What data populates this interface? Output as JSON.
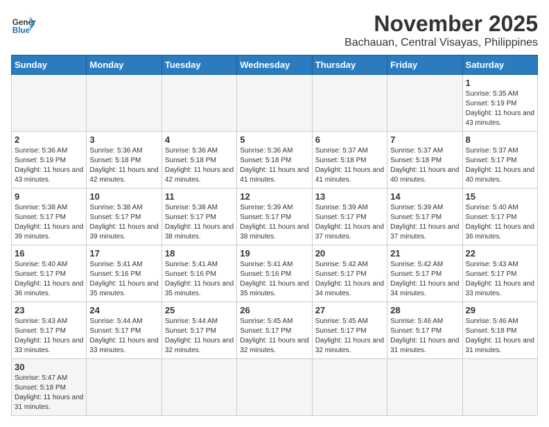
{
  "header": {
    "logo_general": "General",
    "logo_blue": "Blue",
    "month_title": "November 2025",
    "location": "Bachauan, Central Visayas, Philippines"
  },
  "weekdays": [
    "Sunday",
    "Monday",
    "Tuesday",
    "Wednesday",
    "Thursday",
    "Friday",
    "Saturday"
  ],
  "weeks": [
    [
      {
        "day": "",
        "sunrise": "",
        "sunset": "",
        "daylight": ""
      },
      {
        "day": "",
        "sunrise": "",
        "sunset": "",
        "daylight": ""
      },
      {
        "day": "",
        "sunrise": "",
        "sunset": "",
        "daylight": ""
      },
      {
        "day": "",
        "sunrise": "",
        "sunset": "",
        "daylight": ""
      },
      {
        "day": "",
        "sunrise": "",
        "sunset": "",
        "daylight": ""
      },
      {
        "day": "",
        "sunrise": "",
        "sunset": "",
        "daylight": ""
      },
      {
        "day": "1",
        "sunrise": "Sunrise: 5:35 AM",
        "sunset": "Sunset: 5:19 PM",
        "daylight": "Daylight: 11 hours and 43 minutes."
      }
    ],
    [
      {
        "day": "2",
        "sunrise": "Sunrise: 5:36 AM",
        "sunset": "Sunset: 5:19 PM",
        "daylight": "Daylight: 11 hours and 43 minutes."
      },
      {
        "day": "3",
        "sunrise": "Sunrise: 5:36 AM",
        "sunset": "Sunset: 5:18 PM",
        "daylight": "Daylight: 11 hours and 42 minutes."
      },
      {
        "day": "4",
        "sunrise": "Sunrise: 5:36 AM",
        "sunset": "Sunset: 5:18 PM",
        "daylight": "Daylight: 11 hours and 42 minutes."
      },
      {
        "day": "5",
        "sunrise": "Sunrise: 5:36 AM",
        "sunset": "Sunset: 5:18 PM",
        "daylight": "Daylight: 11 hours and 41 minutes."
      },
      {
        "day": "6",
        "sunrise": "Sunrise: 5:37 AM",
        "sunset": "Sunset: 5:18 PM",
        "daylight": "Daylight: 11 hours and 41 minutes."
      },
      {
        "day": "7",
        "sunrise": "Sunrise: 5:37 AM",
        "sunset": "Sunset: 5:18 PM",
        "daylight": "Daylight: 11 hours and 40 minutes."
      },
      {
        "day": "8",
        "sunrise": "Sunrise: 5:37 AM",
        "sunset": "Sunset: 5:17 PM",
        "daylight": "Daylight: 11 hours and 40 minutes."
      }
    ],
    [
      {
        "day": "9",
        "sunrise": "Sunrise: 5:38 AM",
        "sunset": "Sunset: 5:17 PM",
        "daylight": "Daylight: 11 hours and 39 minutes."
      },
      {
        "day": "10",
        "sunrise": "Sunrise: 5:38 AM",
        "sunset": "Sunset: 5:17 PM",
        "daylight": "Daylight: 11 hours and 39 minutes."
      },
      {
        "day": "11",
        "sunrise": "Sunrise: 5:38 AM",
        "sunset": "Sunset: 5:17 PM",
        "daylight": "Daylight: 11 hours and 38 minutes."
      },
      {
        "day": "12",
        "sunrise": "Sunrise: 5:39 AM",
        "sunset": "Sunset: 5:17 PM",
        "daylight": "Daylight: 11 hours and 38 minutes."
      },
      {
        "day": "13",
        "sunrise": "Sunrise: 5:39 AM",
        "sunset": "Sunset: 5:17 PM",
        "daylight": "Daylight: 11 hours and 37 minutes."
      },
      {
        "day": "14",
        "sunrise": "Sunrise: 5:39 AM",
        "sunset": "Sunset: 5:17 PM",
        "daylight": "Daylight: 11 hours and 37 minutes."
      },
      {
        "day": "15",
        "sunrise": "Sunrise: 5:40 AM",
        "sunset": "Sunset: 5:17 PM",
        "daylight": "Daylight: 11 hours and 36 minutes."
      }
    ],
    [
      {
        "day": "16",
        "sunrise": "Sunrise: 5:40 AM",
        "sunset": "Sunset: 5:17 PM",
        "daylight": "Daylight: 11 hours and 36 minutes."
      },
      {
        "day": "17",
        "sunrise": "Sunrise: 5:41 AM",
        "sunset": "Sunset: 5:16 PM",
        "daylight": "Daylight: 11 hours and 35 minutes."
      },
      {
        "day": "18",
        "sunrise": "Sunrise: 5:41 AM",
        "sunset": "Sunset: 5:16 PM",
        "daylight": "Daylight: 11 hours and 35 minutes."
      },
      {
        "day": "19",
        "sunrise": "Sunrise: 5:41 AM",
        "sunset": "Sunset: 5:16 PM",
        "daylight": "Daylight: 11 hours and 35 minutes."
      },
      {
        "day": "20",
        "sunrise": "Sunrise: 5:42 AM",
        "sunset": "Sunset: 5:17 PM",
        "daylight": "Daylight: 11 hours and 34 minutes."
      },
      {
        "day": "21",
        "sunrise": "Sunrise: 5:42 AM",
        "sunset": "Sunset: 5:17 PM",
        "daylight": "Daylight: 11 hours and 34 minutes."
      },
      {
        "day": "22",
        "sunrise": "Sunrise: 5:43 AM",
        "sunset": "Sunset: 5:17 PM",
        "daylight": "Daylight: 11 hours and 33 minutes."
      }
    ],
    [
      {
        "day": "23",
        "sunrise": "Sunrise: 5:43 AM",
        "sunset": "Sunset: 5:17 PM",
        "daylight": "Daylight: 11 hours and 33 minutes."
      },
      {
        "day": "24",
        "sunrise": "Sunrise: 5:44 AM",
        "sunset": "Sunset: 5:17 PM",
        "daylight": "Daylight: 11 hours and 33 minutes."
      },
      {
        "day": "25",
        "sunrise": "Sunrise: 5:44 AM",
        "sunset": "Sunset: 5:17 PM",
        "daylight": "Daylight: 11 hours and 32 minutes."
      },
      {
        "day": "26",
        "sunrise": "Sunrise: 5:45 AM",
        "sunset": "Sunset: 5:17 PM",
        "daylight": "Daylight: 11 hours and 32 minutes."
      },
      {
        "day": "27",
        "sunrise": "Sunrise: 5:45 AM",
        "sunset": "Sunset: 5:17 PM",
        "daylight": "Daylight: 11 hours and 32 minutes."
      },
      {
        "day": "28",
        "sunrise": "Sunrise: 5:46 AM",
        "sunset": "Sunset: 5:17 PM",
        "daylight": "Daylight: 11 hours and 31 minutes."
      },
      {
        "day": "29",
        "sunrise": "Sunrise: 5:46 AM",
        "sunset": "Sunset: 5:18 PM",
        "daylight": "Daylight: 11 hours and 31 minutes."
      }
    ],
    [
      {
        "day": "30",
        "sunrise": "Sunrise: 5:47 AM",
        "sunset": "Sunset: 5:18 PM",
        "daylight": "Daylight: 11 hours and 31 minutes."
      },
      {
        "day": "",
        "sunrise": "",
        "sunset": "",
        "daylight": ""
      },
      {
        "day": "",
        "sunrise": "",
        "sunset": "",
        "daylight": ""
      },
      {
        "day": "",
        "sunrise": "",
        "sunset": "",
        "daylight": ""
      },
      {
        "day": "",
        "sunrise": "",
        "sunset": "",
        "daylight": ""
      },
      {
        "day": "",
        "sunrise": "",
        "sunset": "",
        "daylight": ""
      },
      {
        "day": "",
        "sunrise": "",
        "sunset": "",
        "daylight": ""
      }
    ]
  ]
}
